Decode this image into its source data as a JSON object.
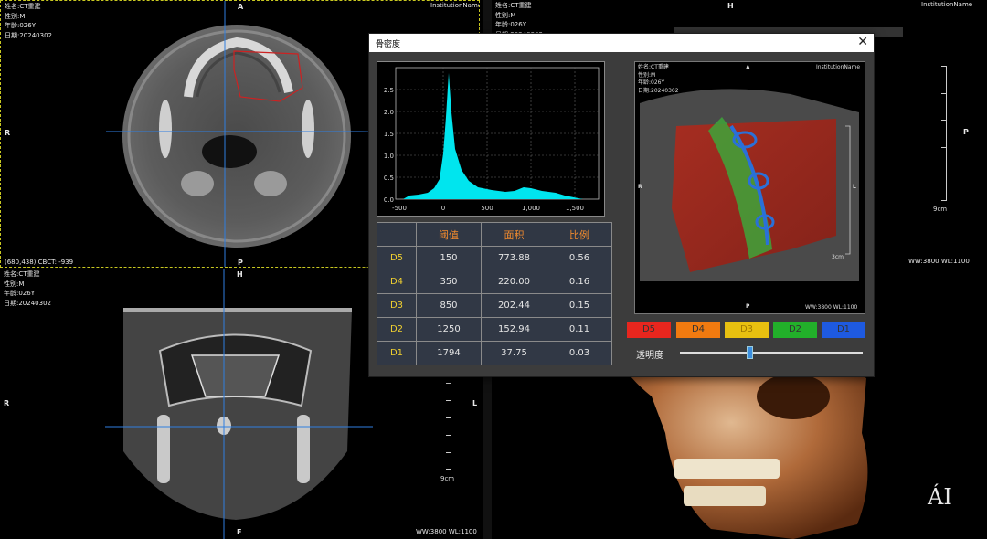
{
  "patient": {
    "name": "姓名:CT重建",
    "sex": "性别:M",
    "age": "年龄:026Y",
    "date": "日期:20240302",
    "institution": "InstitutionName"
  },
  "viewports": {
    "axial": {
      "orient_top": "A",
      "orient_bottom": "P",
      "orient_left": "R",
      "coord_readout": "(680,438) CBCT: -939"
    },
    "coronal": {
      "orient_top": "H",
      "orient_bottom": "F",
      "orient_left": "R",
      "orient_right": "L",
      "scale_label": "9cm",
      "wwwl": "WW:3800 WL:1100"
    },
    "sagittal": {
      "orient_top": "H",
      "orient_right": "P",
      "scale_label": "9cm",
      "wwwl": "WW:3800 WL:1100"
    },
    "volume3d": {
      "watermark": "ÁI"
    }
  },
  "dialog": {
    "title": "骨密度",
    "close": "✕",
    "histogram": {
      "y_ticks": [
        "2.5",
        "2.0",
        "1.5",
        "1.0",
        "0.5",
        "0.0"
      ],
      "x_ticks": [
        "-500",
        "0",
        "500",
        "1,000",
        "1,500"
      ]
    },
    "table": {
      "headers": [
        "",
        "阈值",
        "面积",
        "比例"
      ],
      "rows": [
        {
          "label": "D5",
          "threshold": "150",
          "area": "773.88",
          "ratio": "0.56"
        },
        {
          "label": "D4",
          "threshold": "350",
          "area": "220.00",
          "ratio": "0.16"
        },
        {
          "label": "D3",
          "threshold": "850",
          "area": "202.44",
          "ratio": "0.15"
        },
        {
          "label": "D2",
          "threshold": "1250",
          "area": "152.94",
          "ratio": "0.11"
        },
        {
          "label": "D1",
          "threshold": "1794",
          "area": "37.75",
          "ratio": "0.03"
        }
      ]
    },
    "preview": {
      "orient_top": "A",
      "orient_left": "R",
      "orient_right": "L",
      "orient_bottom": "P",
      "scale_label": "3cm",
      "wwwl": "WW:3800 WL:1100"
    },
    "density_buttons": [
      {
        "label": "D5",
        "color": "#e8261e"
      },
      {
        "label": "D4",
        "color": "#f07a10"
      },
      {
        "label": "D3",
        "color": "#e8c010"
      },
      {
        "label": "D2",
        "color": "#22b02a"
      },
      {
        "label": "D1",
        "color": "#1e5ae0"
      }
    ],
    "transparency": {
      "label": "透明度",
      "value": 0.38
    }
  },
  "colors": {
    "crosshair": "#2f7ee0",
    "histogram_fill": "#00e5ee",
    "header_text": "#f08a2e",
    "row_label": "#f0d030"
  }
}
